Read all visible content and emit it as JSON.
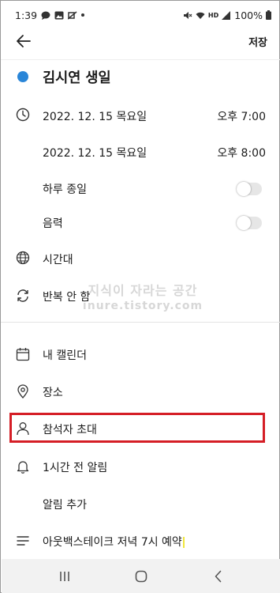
{
  "status_bar": {
    "time": "1:39",
    "battery": "100%",
    "network": "HD"
  },
  "toolbar": {
    "save_label": "저장"
  },
  "event": {
    "title": "김시연 생일",
    "color": "#2a86d8"
  },
  "schedule": {
    "start_date": "2022. 12. 15 목요일",
    "start_time": "오후 7:00",
    "end_date": "2022. 12. 15 목요일",
    "end_time": "오후 8:00",
    "all_day_label": "하루 종일",
    "all_day_on": false,
    "lunar_label": "음력",
    "lunar_on": false,
    "timezone_label": "시간대",
    "repeat_label": "반복 안 함"
  },
  "watermark": {
    "line1": "지식이 자라는 공간",
    "line2": "inure.tistory.com"
  },
  "details": {
    "calendar_label": "내 캘린더",
    "location_label": "장소",
    "invite_label": "참석자 초대",
    "reminder_label": "1시간 전 알림",
    "add_reminder_label": "알림 추가",
    "memo_label": "아웃백스테이크 저녁 7시 예약"
  },
  "highlight_color": "#d51e26",
  "icons": {
    "back": "arrow-left-icon",
    "clock": "clock-icon",
    "globe": "globe-icon",
    "repeat": "repeat-icon",
    "calendar": "calendar-icon",
    "location": "location-pin-icon",
    "person": "person-icon",
    "bell": "bell-icon",
    "memo": "memo-lines-icon"
  }
}
